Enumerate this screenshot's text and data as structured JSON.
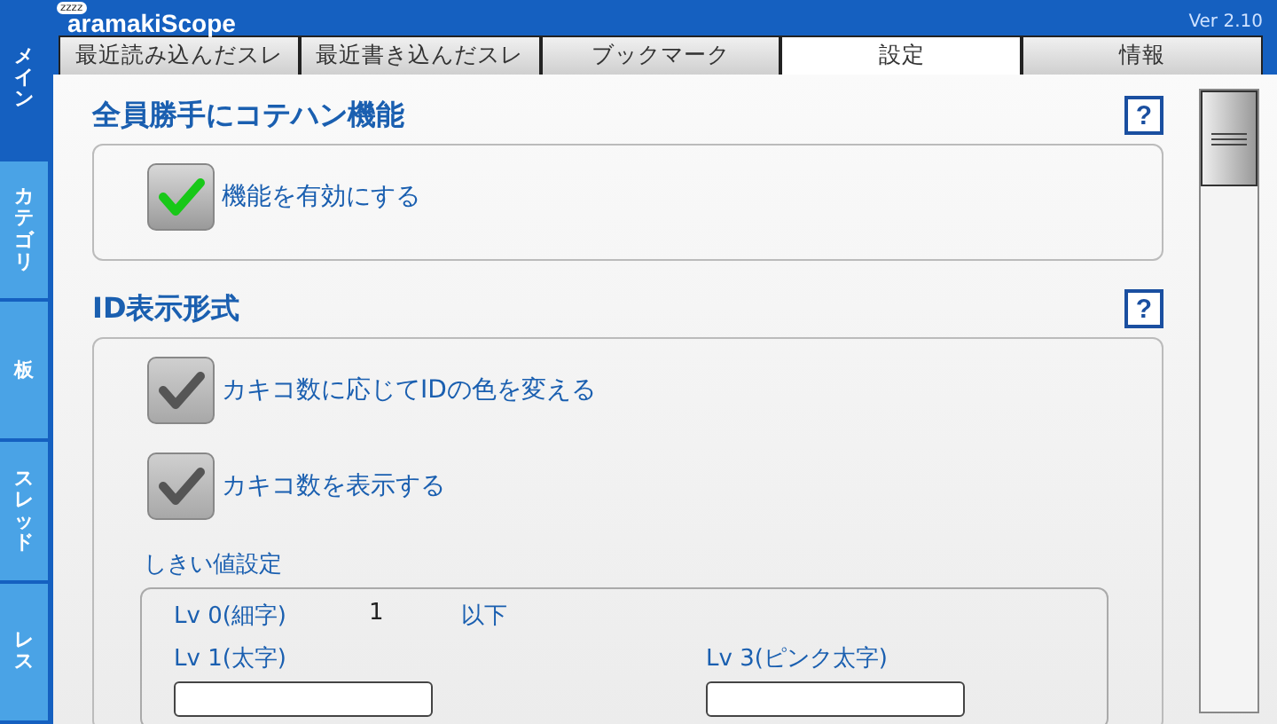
{
  "app": {
    "logo": "aramakiScope",
    "logo_bubble": "zzzz",
    "version": "Ver 2.10"
  },
  "tabs": [
    {
      "label": "最近読み込んだスレ",
      "selected": false
    },
    {
      "label": "最近書き込んだスレ",
      "selected": false
    },
    {
      "label": "ブックマーク",
      "selected": false
    },
    {
      "label": "設定",
      "selected": true
    },
    {
      "label": "情報",
      "selected": false
    }
  ],
  "side_tabs": [
    {
      "label": "メイン",
      "selected": true
    },
    {
      "label": "カテゴリ",
      "selected": false
    },
    {
      "label": "板",
      "selected": false
    },
    {
      "label": "スレッド",
      "selected": false
    },
    {
      "label": "レス",
      "selected": false
    }
  ],
  "sections": [
    {
      "title": "全員勝手にコテハン機能",
      "help": "?",
      "options": [
        {
          "label": "機能を有効にする",
          "checked": true,
          "disabled": false
        }
      ]
    },
    {
      "title": "ID表示形式",
      "help": "?",
      "options": [
        {
          "label": "カキコ数に応じてIDの色を変える",
          "checked": true,
          "disabled": true
        },
        {
          "label": "カキコ数を表示する",
          "checked": true,
          "disabled": true
        }
      ],
      "threshold": {
        "title": "しきい値設定",
        "levels": [
          {
            "kind": "fixed",
            "label": "Lv 0(細字)",
            "value": "1",
            "suffix": "以下"
          },
          {
            "kind": "field",
            "label": "Lv 1(太字)"
          },
          {
            "kind": "field",
            "label": "Lv 3(ピンク太字)"
          }
        ]
      }
    }
  ]
}
